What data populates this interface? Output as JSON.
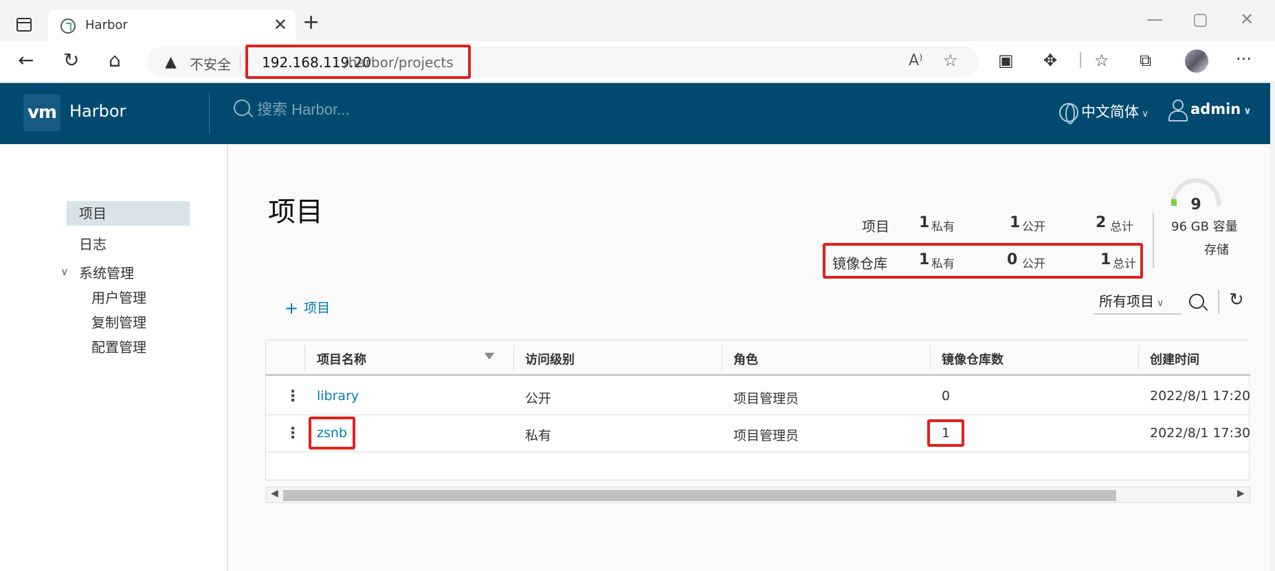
{
  "browser": {
    "tab_title": "Harbor",
    "tab_close": "✕",
    "new_tab": "+",
    "insecure_label": "不安全",
    "url_host": "192.168.119.20",
    "url_path": "/harbor/projects",
    "win_min": "—",
    "win_max": "▢",
    "win_close": "✕",
    "icons": [
      "back-icon",
      "refresh-icon",
      "home-icon",
      "read-aloud-icon",
      "add-favorite-icon",
      "extension-icon",
      "puzzle-icon",
      "favorites-icon",
      "collections-icon",
      "profile-avatar",
      "more-icon"
    ]
  },
  "header": {
    "logo": "vm",
    "brand": "Harbor",
    "search_placeholder": "搜索 Harbor...",
    "language": "中文简体",
    "user": "admin"
  },
  "sidebar": {
    "items": [
      {
        "label": "项目"
      },
      {
        "label": "日志"
      },
      {
        "label": "系统管理"
      },
      {
        "label": "用户管理"
      },
      {
        "label": "复制管理"
      },
      {
        "label": "配置管理"
      }
    ]
  },
  "main": {
    "title": "项目",
    "summary": {
      "projects_label": "项目",
      "projects_private": "1",
      "projects_public": "1",
      "projects_total": "2",
      "repos_label": "镜像仓库",
      "repos_private": "1",
      "repos_public": "0",
      "repos_total": "1",
      "private_unit": "私有",
      "public_unit": "公开",
      "total_unit": "总计"
    },
    "quota": {
      "count": "9",
      "capacity": "96 GB 容量",
      "storage_label": "存储"
    },
    "add_project_label": "项目",
    "filter_selected": "所有项目",
    "table": {
      "headers": [
        "项目名称",
        "访问级别",
        "角色",
        "镜像仓库数",
        "创建时间"
      ],
      "rows": [
        {
          "name": "library",
          "access": "公开",
          "role": "项目管理员",
          "repos": "0",
          "created": "2022/8/1 17:20"
        },
        {
          "name": "zsnb",
          "access": "私有",
          "role": "项目管理员",
          "repos": "1",
          "created": "2022/8/1 17:30"
        }
      ]
    }
  },
  "colors": {
    "header_bg": "#004a70",
    "link": "#0079b8",
    "highlight_box": "#e3201a",
    "nav_active_bg": "#d8e3ea"
  }
}
